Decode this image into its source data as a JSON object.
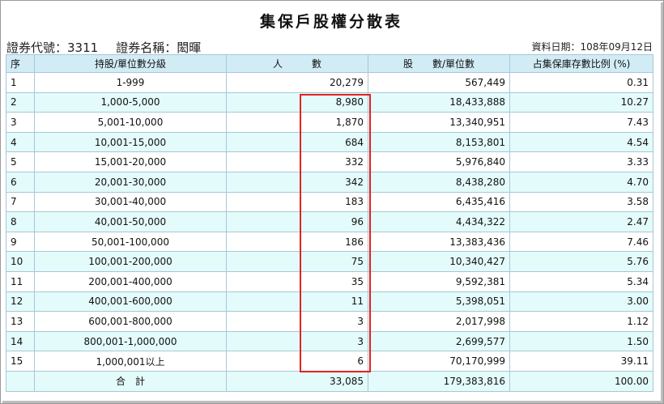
{
  "title": "集保戶股權分散表",
  "stock": {
    "code_label": "證券代號：",
    "code": "3311",
    "name_label": "證券名稱：",
    "name": "閎暉"
  },
  "data_date": "資料日期：108年09月12日",
  "columns": {
    "index": "序",
    "level": "持股/單位數分級",
    "holders": "人　　　數",
    "shares": "股　　數/單位數",
    "percent": "占集保庫存數比例 (%)"
  },
  "rows": [
    {
      "index": "1",
      "level": "1-999",
      "holders": "20,279",
      "shares": "567,449",
      "percent": "0.31"
    },
    {
      "index": "2",
      "level": "1,000-5,000",
      "holders": "8,980",
      "shares": "18,433,888",
      "percent": "10.27"
    },
    {
      "index": "3",
      "level": "5,001-10,000",
      "holders": "1,870",
      "shares": "13,340,951",
      "percent": "7.43"
    },
    {
      "index": "4",
      "level": "10,001-15,000",
      "holders": "684",
      "shares": "8,153,801",
      "percent": "4.54"
    },
    {
      "index": "5",
      "level": "15,001-20,000",
      "holders": "332",
      "shares": "5,976,840",
      "percent": "3.33"
    },
    {
      "index": "6",
      "level": "20,001-30,000",
      "holders": "342",
      "shares": "8,438,280",
      "percent": "4.70"
    },
    {
      "index": "7",
      "level": "30,001-40,000",
      "holders": "183",
      "shares": "6,435,416",
      "percent": "3.58"
    },
    {
      "index": "8",
      "level": "40,001-50,000",
      "holders": "96",
      "shares": "4,434,322",
      "percent": "2.47"
    },
    {
      "index": "9",
      "level": "50,001-100,000",
      "holders": "186",
      "shares": "13,383,436",
      "percent": "7.46"
    },
    {
      "index": "10",
      "level": "100,001-200,000",
      "holders": "75",
      "shares": "10,340,427",
      "percent": "5.76"
    },
    {
      "index": "11",
      "level": "200,001-400,000",
      "holders": "35",
      "shares": "9,592,381",
      "percent": "5.34"
    },
    {
      "index": "12",
      "level": "400,001-600,000",
      "holders": "11",
      "shares": "5,398,051",
      "percent": "3.00"
    },
    {
      "index": "13",
      "level": "600,001-800,000",
      "holders": "3",
      "shares": "2,017,998",
      "percent": "1.12"
    },
    {
      "index": "14",
      "level": "800,001-1,000,000",
      "holders": "3",
      "shares": "2,699,577",
      "percent": "1.50"
    },
    {
      "index": "15",
      "level": "1,000,001以上",
      "holders": "6",
      "shares": "70,170,999",
      "percent": "39.11"
    }
  ],
  "total": {
    "label": "合　計",
    "holders": "33,085",
    "shares": "179,383,816",
    "percent": "100.00"
  },
  "colors": {
    "header_bg": "#d2ecf5",
    "alt_row_bg": "#e4fbfb",
    "grid_line": "#a7c7d6",
    "highlight_box": "#e32222"
  }
}
